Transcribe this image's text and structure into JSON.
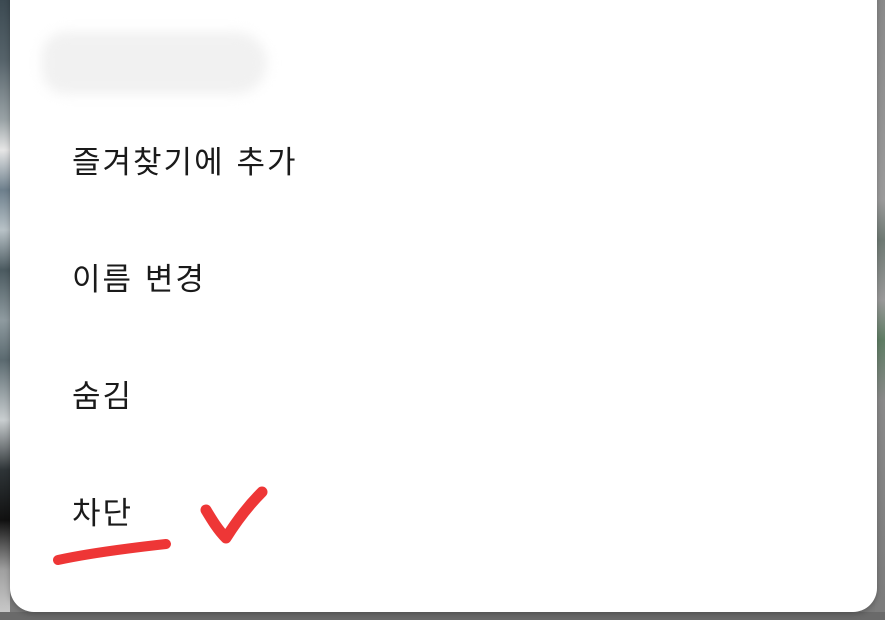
{
  "menu": {
    "items": [
      {
        "label": "즐겨찾기에 추가"
      },
      {
        "label": "이름 변경"
      },
      {
        "label": "숨김"
      },
      {
        "label": "차단"
      }
    ]
  },
  "annotation": {
    "color": "#ee3636",
    "marks": [
      "underline",
      "check-mark-icon"
    ],
    "marked_item": "차단"
  }
}
